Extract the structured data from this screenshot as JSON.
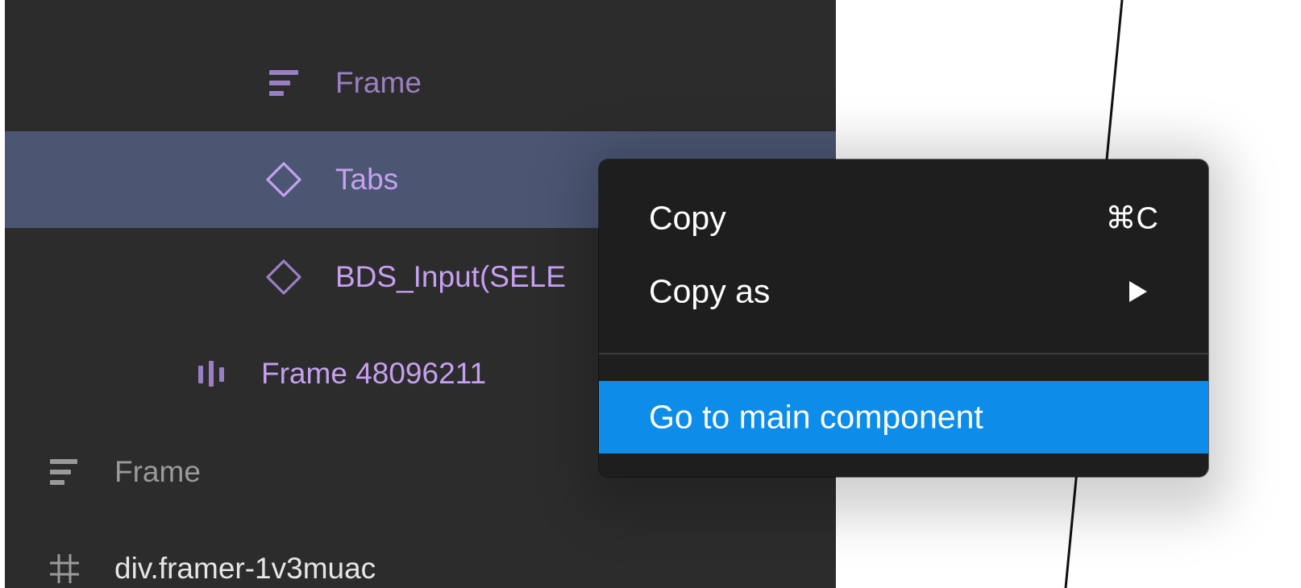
{
  "layers_panel": {
    "items": [
      {
        "label": "Frame",
        "icon": "auto-layout-vertical-icon",
        "color": "#9b7fc4"
      },
      {
        "label": "Tabs",
        "icon": "component-instance-icon",
        "color": "#c6a0f0",
        "selected": true
      },
      {
        "label": "BDS_Input(SELE",
        "icon": "component-instance-icon",
        "color": "#c6a0f0"
      },
      {
        "label": "Frame 48096211",
        "icon": "auto-layout-horizontal-icon",
        "color": "#c6a0f0"
      },
      {
        "label": "Frame",
        "icon": "auto-layout-vertical-icon",
        "color": "#9a9a9a"
      },
      {
        "label": "div.framer-1v3muac",
        "icon": "frame-hash-icon",
        "color": "#e6e6e6"
      }
    ],
    "selected_color": "#4b5673",
    "background": "#2c2c2c"
  },
  "context_menu": {
    "items": [
      {
        "label": "Copy",
        "shortcut": "⌘C"
      },
      {
        "label": "Copy as",
        "has_submenu": true,
        "submenu_icon": "chevron-right-icon"
      },
      {
        "label": "Go to main component",
        "highlighted": true
      }
    ],
    "highlight_color": "#0d8ce9",
    "background": "#1e1e1e"
  }
}
